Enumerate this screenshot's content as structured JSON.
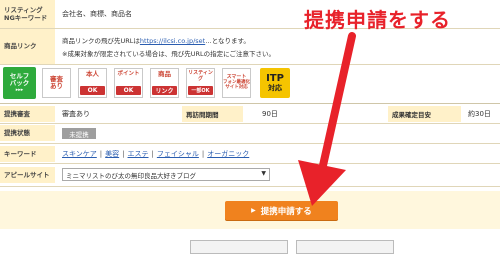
{
  "rows": {
    "listing_label": "リスティング",
    "listing_label2": "NGキーワード",
    "listing_value": "会社名、商標、商品名",
    "product_link_label": "商品リンク",
    "product_link_line1_prefix": "商品リンクの飛び先URLは",
    "product_link_url": "https://ilcsi.co.jp/set",
    "product_link_line1_suffix": "…となります。",
    "product_link_line2": "※成果対象が限定されている場合は、飛び先URLの指定にご注意下さい。"
  },
  "badges": [
    {
      "top": "審査",
      "top2": "あり",
      "bottom": ""
    },
    {
      "top": "本人",
      "top2": "",
      "bottom": "OK"
    },
    {
      "top": "ポイント",
      "top2": "",
      "bottom": "OK"
    },
    {
      "top": "商品",
      "top2": "",
      "bottom": "リンク"
    },
    {
      "top": "リスティング",
      "top2": "",
      "bottom": "一部OK"
    },
    {
      "top": "スマート",
      "top2": "フォン最適化サイト対応",
      "bottom": ""
    }
  ],
  "selfback": {
    "line1": "セルフ",
    "line2": "バック",
    "line3": "▸▸▸"
  },
  "itp": {
    "line1": "ITP",
    "line2": "対応"
  },
  "table": {
    "review_label": "提携審査",
    "review_value": "審査あり",
    "revisit_label": "再訪問期間",
    "revisit_value": "90日",
    "confirm_label": "成果確定目安",
    "confirm_value": "約30日",
    "status_label": "提携状態",
    "status_value": "未提携",
    "keyword_label": "キーワード",
    "keywords": [
      "スキンケア",
      "美容",
      "エステ",
      "フェイシャル",
      "オーガニック"
    ],
    "site_label": "アピールサイト",
    "site_value": "ミニマリストのび太の無印良品大好きブログ"
  },
  "apply_button": "提携申請する",
  "annotation": "提携申請をする",
  "colors": {
    "accent": "#f0821e",
    "red": "#e8222a",
    "label_bg": "#fff1c9"
  }
}
